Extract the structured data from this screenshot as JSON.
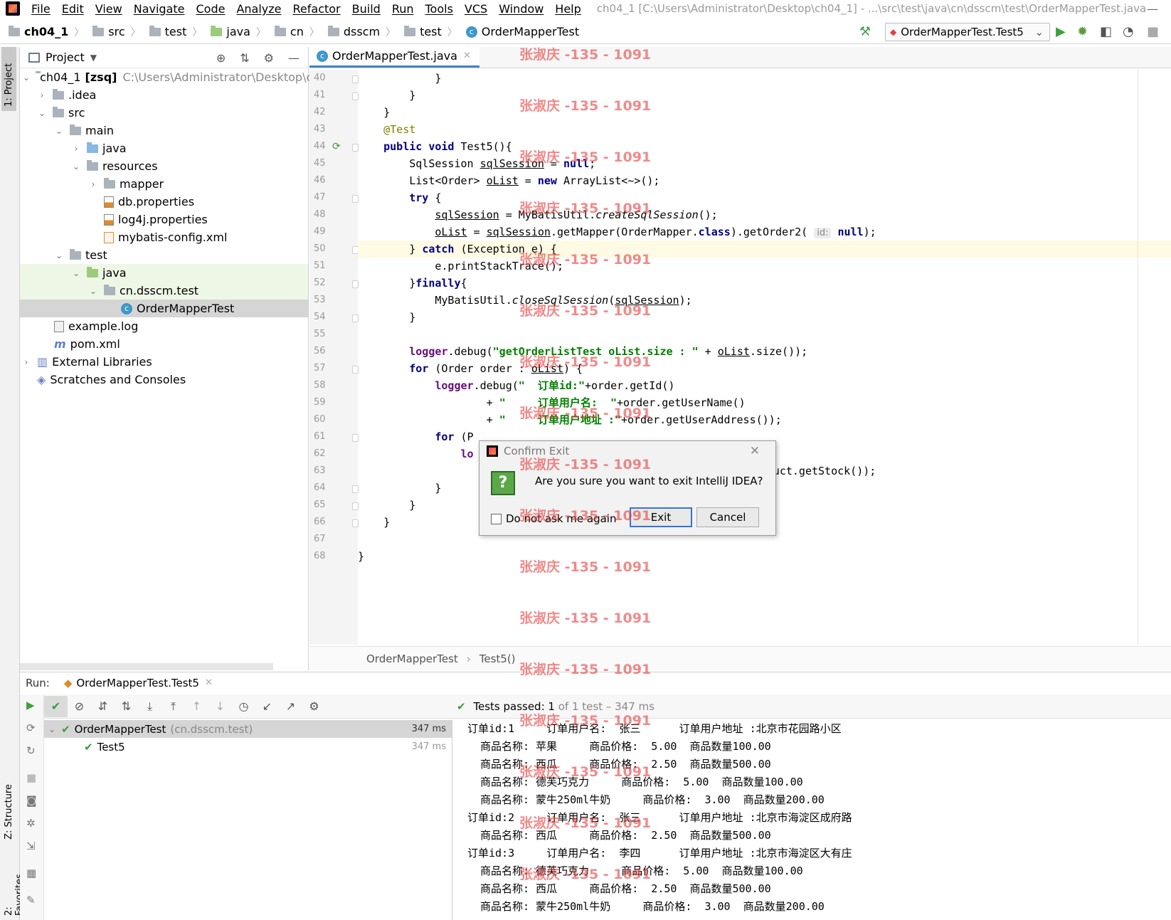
{
  "menubar": {
    "items": [
      "File",
      "Edit",
      "View",
      "Navigate",
      "Code",
      "Analyze",
      "Refactor",
      "Build",
      "Run",
      "Tools",
      "VCS",
      "Window",
      "Help"
    ],
    "window_title": "ch04_1 [C:\\Users\\Administrator\\Desktop\\ch04_1] - ...\\src\\test\\java\\cn\\dsscm\\test\\OrderMapperTest.java"
  },
  "navbar": {
    "crumbs": [
      "ch04_1",
      "src",
      "test",
      "java",
      "cn",
      "dsscm",
      "test",
      "OrderMapperTest"
    ],
    "run_config": "OrderMapperTest.Test5"
  },
  "left_strip": {
    "project_tab": "1: Project",
    "structure_tab": "Z: Structure",
    "favorites_tab": "2: Favorites"
  },
  "project": {
    "title": "Project",
    "root_name": "ch04_1",
    "root_module": "[zsq]",
    "root_path": "C:\\Users\\Administrator\\Desktop\\ch04_1",
    "tree": [
      ".idea",
      "src",
      "main",
      "java",
      "resources",
      "mapper",
      "db.properties",
      "log4j.properties",
      "mybatis-config.xml",
      "test",
      "java",
      "cn.dsscm.test",
      "OrderMapperTest",
      "example.log",
      "pom.xml",
      "External Libraries",
      "Scratches and Consoles"
    ]
  },
  "editor": {
    "tab": "OrderMapperTest.java",
    "current_line": 50,
    "line_numbers": [
      "40",
      "41",
      "42",
      "43",
      "44",
      "45",
      "46",
      "47",
      "48",
      "49",
      "50",
      "51",
      "52",
      "53",
      "54",
      "55",
      "56",
      "57",
      "58",
      "59",
      "60",
      "61",
      "62",
      "63",
      "64",
      "65",
      "66",
      "67",
      "68"
    ],
    "param_hint": "id:",
    "breadcrumb": [
      "OrderMapperTest",
      "Test5()"
    ]
  },
  "dialog": {
    "title": "Confirm Exit",
    "message": "Are you sure you want to exit IntelliJ IDEA?",
    "checkbox": "Do not ask me again",
    "exit": "Exit",
    "cancel": "Cancel"
  },
  "run": {
    "label": "Run:",
    "tab": "OrderMapperTest.Test5",
    "status_main": "Tests passed: 1",
    "status_muted": "of 1 test – 347 ms",
    "tree": [
      {
        "name": "OrderMapperTest",
        "pkg": "(cn.dsscm.test)",
        "time": "347 ms"
      },
      {
        "name": "Test5",
        "time": "347 ms"
      }
    ],
    "console": [
      "订单id:1     订单用户名:  张三      订单用户地址 :北京市花园路小区",
      "商品名称: 苹果     商品价格:  5.00  商品数量100.00",
      "商品名称: 西瓜     商品价格:  2.50  商品数量500.00",
      "商品名称: 德芙巧克力     商品价格:  5.00  商品数量100.00",
      "商品名称: 蒙牛250ml牛奶     商品价格:  3.00  商品数量200.00",
      "订单id:2     订单用户名:  张三      订单用户地址 :北京市海淀区成府路",
      "商品名称: 西瓜     商品价格:  2.50  商品数量500.00",
      "订单id:3     订单用户名:  李四      订单用户地址 :北京市海淀区大有庄",
      "商品名称: 德芙巧克力     商品价格:  5.00  商品数量100.00",
      "商品名称: 西瓜     商品价格:  2.50  商品数量500.00",
      "商品名称: 蒙牛250ml牛奶     商品价格:  3.00  商品数量200.00"
    ]
  },
  "watermark": "张淑庆 -135 - 1091",
  "colors": {
    "accent": "#4083c9",
    "ok_green": "#3a9c3a",
    "watermark": "#e63c3c",
    "current_line": "#fffae3"
  }
}
